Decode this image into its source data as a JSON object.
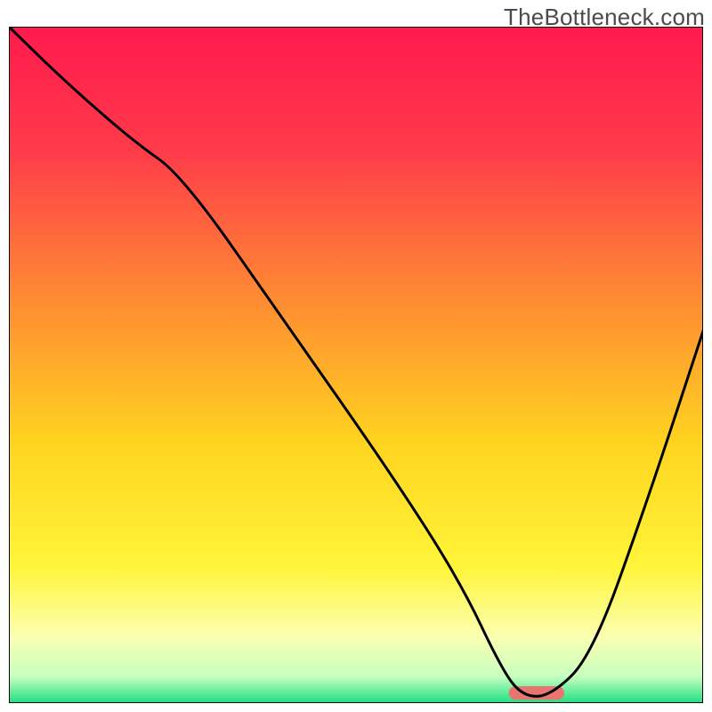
{
  "watermark": "TheBottleneck.com",
  "chart_data": {
    "type": "line",
    "title": "",
    "xlabel": "",
    "ylabel": "",
    "xlim": [
      0,
      100
    ],
    "ylim": [
      0,
      100
    ],
    "grid": false,
    "legend": false,
    "background": {
      "gradient_stops": [
        {
          "pos": 0,
          "color": "#ff1a4d"
        },
        {
          "pos": 18,
          "color": "#ff3a4a"
        },
        {
          "pos": 40,
          "color": "#ff8a33"
        },
        {
          "pos": 62,
          "color": "#ffd51f"
        },
        {
          "pos": 80,
          "color": "#fff53a"
        },
        {
          "pos": 90,
          "color": "#fbffb0"
        },
        {
          "pos": 96,
          "color": "#c8ffc0"
        },
        {
          "pos": 100,
          "color": "#1de082"
        }
      ],
      "note": "vertical rainbow gradient (red top → green bottom) representing bottleneck severity; y position encodes severity"
    },
    "series": [
      {
        "name": "bottleneck-curve",
        "x": [
          0,
          8,
          18,
          25,
          40,
          55,
          65,
          71,
          74,
          78,
          84,
          92,
          100
        ],
        "y": [
          100,
          92,
          83,
          78,
          56,
          34,
          18,
          5,
          1,
          1,
          7,
          30,
          55
        ],
        "color": "#000000",
        "stroke_width": 3
      }
    ],
    "annotations": [
      {
        "name": "optimal-zone-marker",
        "shape": "rounded-rect",
        "x0": 72,
        "x1": 80,
        "y0": 0.5,
        "y1": 2.5,
        "fill": "#e8756f"
      }
    ]
  }
}
